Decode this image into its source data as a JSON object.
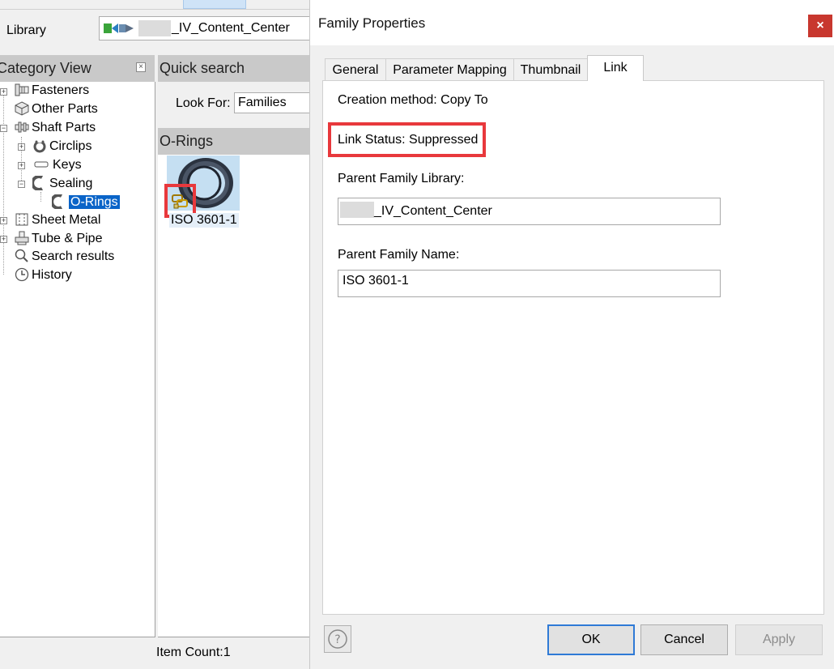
{
  "app": {
    "library_label": "Library",
    "library_value": "_IV_Content_Center",
    "category_view_title": "Category View",
    "category_close": "×",
    "tree": [
      {
        "label": "Fasteners",
        "icon": "fasteners-icon",
        "expander": "+"
      },
      {
        "label": "Other Parts",
        "icon": "other-parts-icon",
        "expander": ""
      },
      {
        "label": "Shaft Parts",
        "icon": "shaft-parts-icon",
        "expander": "−"
      },
      {
        "label": "Circlips",
        "icon": "circlips-icon",
        "expander": "+"
      },
      {
        "label": "Keys",
        "icon": "keys-icon",
        "expander": "+"
      },
      {
        "label": "Sealing",
        "icon": "sealing-icon",
        "expander": "−"
      },
      {
        "label": "O-Rings",
        "icon": "o-rings-icon",
        "expander": "",
        "selected": true
      },
      {
        "label": "Sheet Metal",
        "icon": "sheet-metal-icon",
        "expander": "+"
      },
      {
        "label": "Tube & Pipe",
        "icon": "tube-pipe-icon",
        "expander": "+"
      },
      {
        "label": "Search results",
        "icon": "search-icon",
        "expander": ""
      },
      {
        "label": "History",
        "icon": "history-icon",
        "expander": ""
      }
    ],
    "quick_search_title": "Quick search",
    "look_for_label": "Look For:",
    "look_for_value": "Families",
    "family_panel_title": "O-Rings",
    "family_item_label": "ISO 3601-1",
    "item_count": "Item Count:1",
    "accent_color": "#0a64c8",
    "highlight_color": "#e8383c"
  },
  "dialog": {
    "title": "Family Properties",
    "close": "×",
    "tabs": [
      "General",
      "Parameter Mapping",
      "Thumbnail",
      "Link"
    ],
    "active_tab": "Link",
    "creation_method": "Creation method: Copy To",
    "link_status": "Link Status: Suppressed",
    "parent_library_label": "Parent Family Library:",
    "parent_library_value": "_IV_Content_Center",
    "parent_name_label": "Parent Family Name:",
    "parent_name_value": "ISO 3601-1",
    "buttons": {
      "ok": "OK",
      "cancel": "Cancel",
      "apply": "Apply"
    }
  }
}
